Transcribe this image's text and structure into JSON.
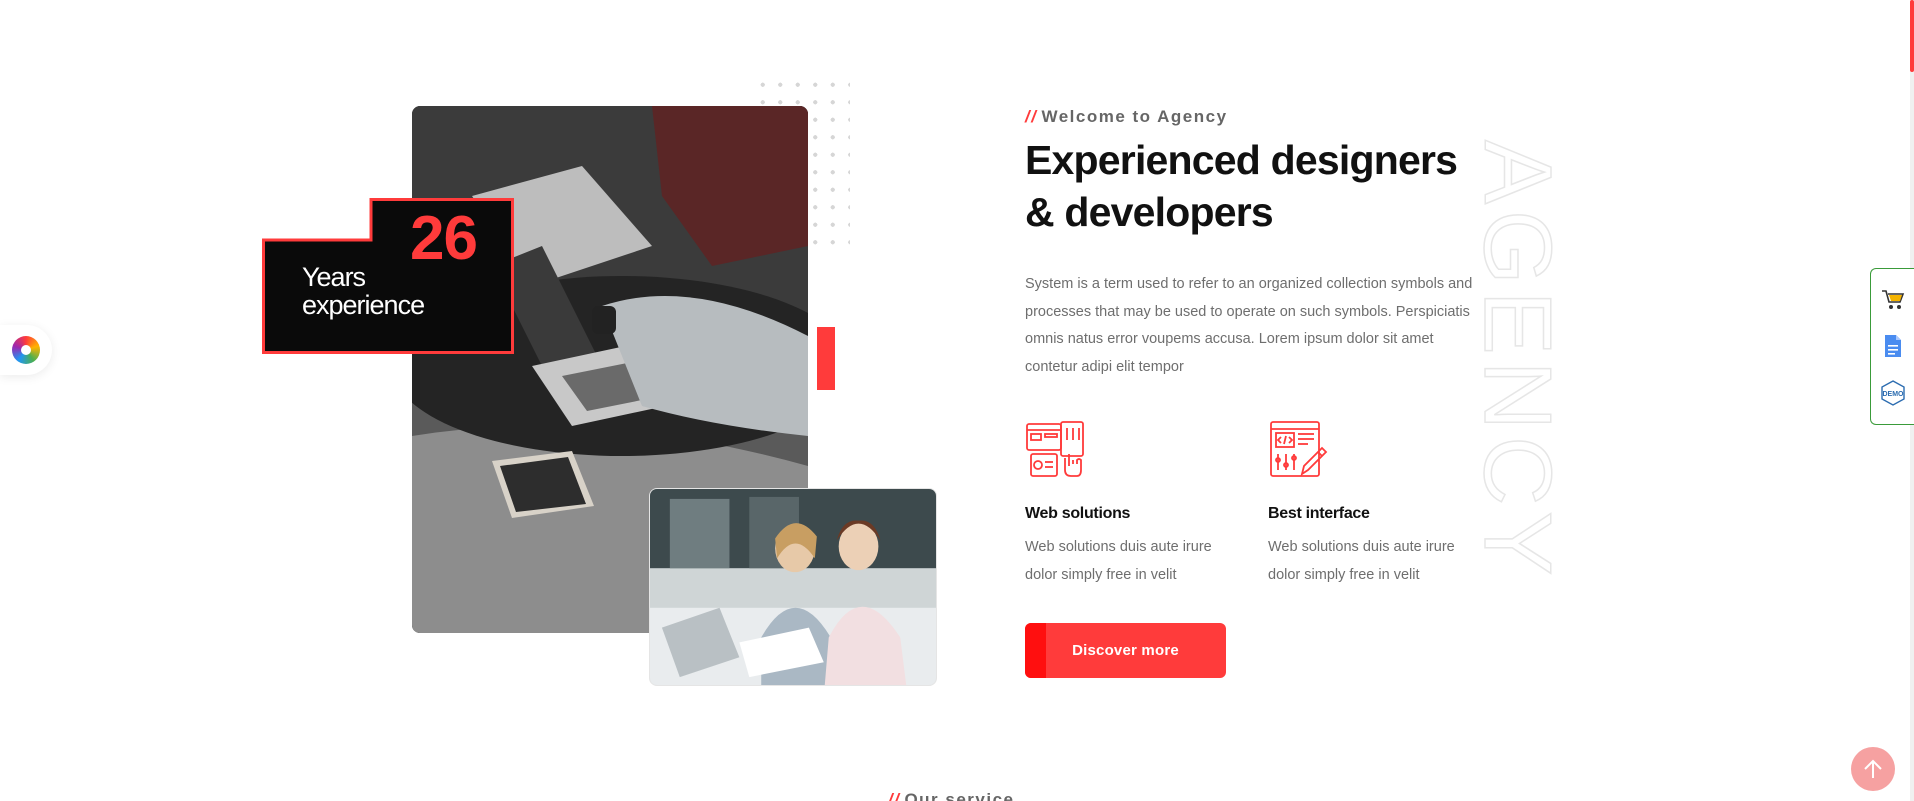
{
  "about": {
    "tagline_slashes": "//",
    "tagline": "Welcome to Agency",
    "heading": "Experienced designers & developers",
    "description": "System is a term used to refer to an organized collection symbols and processes that may be used to operate on such symbols. Perspiciatis omnis natus error voupems accusa. Lorem ipsum dolor sit amet contetur adipi elit tempor",
    "badge": {
      "number": "26",
      "line1": "Years",
      "line2": "experience"
    },
    "features": [
      {
        "icon": "web-design-icon",
        "title": "Web solutions",
        "text": "Web solutions duis aute irure dolor simply free in velit"
      },
      {
        "icon": "code-interface-icon",
        "title": "Best interface",
        "text": "Web solutions duis aute irure dolor simply free in velit"
      }
    ],
    "button_label": "Discover more",
    "watermark": "AGENCY"
  },
  "next_section": {
    "slashes": "//",
    "label": "Our service"
  },
  "side_panel": {
    "icons": [
      "cart-icon",
      "document-icon",
      "demo-icon"
    ]
  },
  "colors": {
    "accent": "#ff3b3b",
    "heading": "#111111",
    "body_text": "#6e6e6e",
    "panel_border": "#3a9b3a"
  }
}
